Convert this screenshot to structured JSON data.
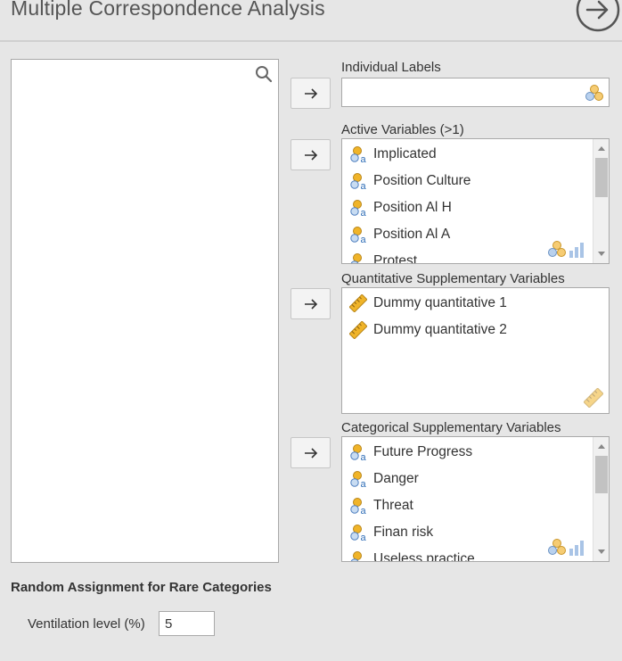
{
  "header": {
    "title": "Multiple Correspondence Analysis",
    "back_icon": "arrow-right-circle-icon"
  },
  "source": {
    "search_icon": "search-icon"
  },
  "individual_labels": {
    "label": "Individual Labels",
    "items": []
  },
  "active_variables": {
    "label": "Active Variables (>1)",
    "items": [
      "Implicated",
      "Position Culture",
      "Position Al H",
      "Position Al A",
      "Protest"
    ]
  },
  "quantitative_supplementary": {
    "label": "Quantitative Supplementary Variables",
    "items": [
      "Dummy quantitative 1",
      "Dummy quantitative 2"
    ]
  },
  "categorical_supplementary": {
    "label": "Categorical Supplementary Variables",
    "items": [
      "Future Progress",
      "Danger",
      "Threat",
      "Finan risk",
      "Useless practice"
    ]
  },
  "rare_categories": {
    "title": "Random Assignment for Rare Categories",
    "ventilation_label": "Ventilation level (%)",
    "ventilation_value": "5"
  },
  "colors": {
    "nominal_icon": "#f0b429",
    "nominal_blue": "#3a7bc8",
    "scale_icon": "#f0b429"
  }
}
